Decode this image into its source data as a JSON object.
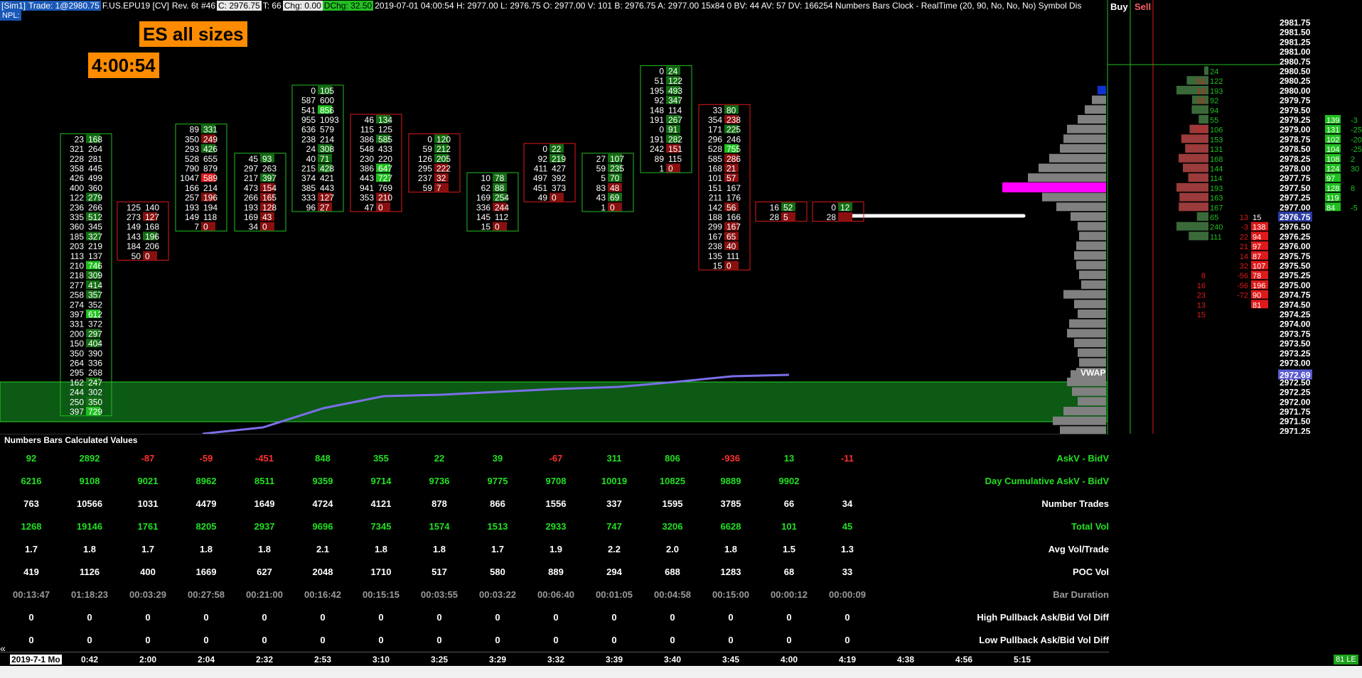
{
  "header": {
    "sim": "[Sim1]",
    "trade": "Trade: 1@2980.75",
    "symbol": "F.US.EPU19 [CV]",
    "rev": "Rev. 6t",
    "num": "#46",
    "close": "C: 2976.75",
    "trades": "T: 66",
    "chg": "Chg: 0.00",
    "dchg": "DChg: 32.50",
    "info": "2019-07-01 04:00:54 H: 2977.00 L: 2976.75 O: 2977.00 V: 101 B: 2976.75 A: 2977.00 15x84 0 BV: 44 AV: 57 DV: 166254 Numbers Bars Clock - RealTime  (20, 90, No, No, No) Symbol Dis",
    "npl": "NPL:",
    "buy": "Buy",
    "sell": "Sell",
    "colors": {
      "sim_bg": "#1a58b8",
      "close_bg": "#e8e8e8",
      "chg_bg": "#e8e8e8",
      "dchg_bg": "#22c022"
    }
  },
  "chart": {
    "title": "ES all sizes",
    "clock": "4:00:54",
    "vwap_label": "VWAP",
    "vwap_value": "2972.69",
    "last_price": "2976.75",
    "colors": {
      "up": "#1fbf1f",
      "down": "#e01a1a",
      "profile": "#808080",
      "poc": "#ff00ff",
      "vwap": "#7b6fe8",
      "zone": "#0c5a14"
    }
  },
  "price_axis": {
    "labels": [
      "2981.75",
      "2981.50",
      "2981.25",
      "2981.00",
      "2980.75",
      "2980.50",
      "2980.25",
      "2980.00",
      "2979.75",
      "2979.50",
      "2979.25",
      "2979.00",
      "2978.75",
      "2978.50",
      "2978.25",
      "2978.00",
      "2977.75",
      "2977.50",
      "2977.25",
      "2977.00",
      "2976.75",
      "2976.50",
      "2976.25",
      "2976.00",
      "2975.75",
      "2975.50",
      "2975.25",
      "2975.00",
      "2974.75",
      "2974.50",
      "2974.25",
      "2974.00",
      "2973.75",
      "2973.50",
      "2973.25",
      "2973.00",
      "2972.75",
      "2972.69",
      "2972.50",
      "2972.25",
      "2972.00",
      "2971.75",
      "2971.50",
      "2971.25"
    ]
  },
  "bars": [
    {
      "time": "0:42",
      "rows": [
        [
          "23",
          "168"
        ],
        [
          "321",
          "264"
        ],
        [
          "228",
          "281"
        ],
        [
          "358",
          "445"
        ],
        [
          "426",
          "499"
        ],
        [
          "400",
          "360"
        ],
        [
          "122",
          "279"
        ],
        [
          "236",
          "266"
        ],
        [
          "335",
          "512"
        ],
        [
          "360",
          "345"
        ],
        [
          "185",
          "327"
        ],
        [
          "203",
          "219"
        ],
        [
          "113",
          "137"
        ],
        [
          "210",
          "746"
        ],
        [
          "218",
          "309"
        ],
        [
          "277",
          "414"
        ],
        [
          "258",
          "357"
        ],
        [
          "274",
          "352"
        ],
        [
          "397",
          "612"
        ],
        [
          "331",
          "372"
        ],
        [
          "200",
          "297"
        ],
        [
          "150",
          "404"
        ],
        [
          "350",
          "390"
        ],
        [
          "264",
          "336"
        ],
        [
          "295",
          "268"
        ],
        [
          "162",
          "247"
        ],
        [
          "244",
          "302"
        ],
        [
          "250",
          "350"
        ],
        [
          "397",
          "729"
        ]
      ],
      "top": "2978.75"
    },
    {
      "time": "2:00",
      "rows": [
        [
          "125",
          "140"
        ],
        [
          "273",
          "127"
        ],
        [
          "149",
          "168"
        ],
        [
          "143",
          "196"
        ],
        [
          "184",
          "206"
        ],
        [
          "50",
          "0"
        ]
      ],
      "top": "2977.00"
    },
    {
      "time": "2:04",
      "rows": [
        [
          "89",
          "331"
        ],
        [
          "350",
          "249"
        ],
        [
          "293",
          "426"
        ],
        [
          "528",
          "655"
        ],
        [
          "790",
          "879"
        ],
        [
          "1047",
          "589"
        ],
        [
          "166",
          "214"
        ],
        [
          "257",
          "196"
        ],
        [
          "193",
          "194"
        ],
        [
          "149",
          "118"
        ],
        [
          "7",
          "0"
        ]
      ],
      "top": "2979.00"
    },
    {
      "time": "2:32",
      "rows": [
        [
          "45",
          "93"
        ],
        [
          "297",
          "263"
        ],
        [
          "217",
          "397"
        ],
        [
          "473",
          "154"
        ],
        [
          "266",
          "165"
        ],
        [
          "193",
          "128"
        ],
        [
          "169",
          "43"
        ],
        [
          "34",
          "0"
        ]
      ],
      "top": "2978.25"
    },
    {
      "time": "2:53",
      "rows": [
        [
          "0",
          "105"
        ],
        [
          "587",
          "600"
        ],
        [
          "541",
          "856"
        ],
        [
          "955",
          "1093"
        ],
        [
          "636",
          "579"
        ],
        [
          "238",
          "214"
        ],
        [
          "24",
          "308"
        ],
        [
          "40",
          "71"
        ],
        [
          "215",
          "428"
        ],
        [
          "374",
          "421"
        ],
        [
          "385",
          "443"
        ],
        [
          "333",
          "127"
        ],
        [
          "96",
          "27"
        ]
      ],
      "top": "2980.00"
    },
    {
      "time": "3:10",
      "rows": [
        [
          "46",
          "134"
        ],
        [
          "115",
          "125"
        ],
        [
          "386",
          "585"
        ],
        [
          "548",
          "433"
        ],
        [
          "230",
          "220"
        ],
        [
          "386",
          "647"
        ],
        [
          "443",
          "727"
        ],
        [
          "941",
          "769"
        ],
        [
          "353",
          "210"
        ],
        [
          "47",
          "0"
        ]
      ],
      "top": "2979.25"
    },
    {
      "time": "3:25",
      "rows": [
        [
          "0",
          "120"
        ],
        [
          "59",
          "212"
        ],
        [
          "126",
          "205"
        ],
        [
          "295",
          "222"
        ],
        [
          "237",
          "32"
        ],
        [
          "59",
          "7"
        ]
      ],
      "top": "2978.75"
    },
    {
      "time": "3:29",
      "rows": [
        [
          "10",
          "78"
        ],
        [
          "62",
          "88"
        ],
        [
          "169",
          "254"
        ],
        [
          "336",
          "244"
        ],
        [
          "145",
          "112"
        ],
        [
          "15",
          "0"
        ]
      ],
      "top": "2977.75"
    },
    {
      "time": "3:32",
      "rows": [
        [
          "0",
          "22"
        ],
        [
          "92",
          "219"
        ],
        [
          "411",
          "427"
        ],
        [
          "497",
          "392"
        ],
        [
          "451",
          "373"
        ],
        [
          "49",
          "0"
        ]
      ],
      "top": "2978.50"
    },
    {
      "time": "3:39",
      "rows": [
        [
          "27",
          "107"
        ],
        [
          "59",
          "235"
        ],
        [
          "5",
          "70"
        ],
        [
          "83",
          "48"
        ],
        [
          "43",
          "69"
        ],
        [
          "1",
          "0"
        ]
      ],
      "top": "2978.25"
    },
    {
      "time": "3:40",
      "rows": [
        [
          "0",
          "24"
        ],
        [
          "51",
          "122"
        ],
        [
          "195",
          "493"
        ],
        [
          "92",
          "347"
        ],
        [
          "148",
          "114"
        ],
        [
          "191",
          "267"
        ],
        [
          "0",
          "91"
        ],
        [
          "191",
          "282"
        ],
        [
          "242",
          "151"
        ],
        [
          "89",
          "115"
        ],
        [
          "1",
          "0"
        ]
      ],
      "top": "2980.50"
    },
    {
      "time": "3:45",
      "rows": [
        [
          "33",
          "80"
        ],
        [
          "354",
          "238"
        ],
        [
          "171",
          "225"
        ],
        [
          "296",
          "246"
        ],
        [
          "528",
          "755"
        ],
        [
          "585",
          "286"
        ],
        [
          "168",
          "21"
        ],
        [
          "101",
          "57"
        ],
        [
          "151",
          "167"
        ],
        [
          "211",
          "176"
        ],
        [
          "142",
          "56"
        ],
        [
          "188",
          "166"
        ],
        [
          "299",
          "167"
        ],
        [
          "167",
          "65"
        ],
        [
          "238",
          "40"
        ],
        [
          "135",
          "111"
        ],
        [
          "15",
          "0"
        ]
      ],
      "top": "2979.50"
    },
    {
      "time": "4:00",
      "rows": [
        [
          "16",
          "52"
        ],
        [
          "28",
          "5"
        ]
      ],
      "top": "2977.00"
    },
    {
      "time": "4:19",
      "rows": [
        [
          "0",
          "12"
        ],
        [
          "28",
          ""
        ]
      ],
      "top": "2977.00"
    }
  ],
  "dom": {
    "left": [
      [
        "24"
      ],
      [
        "122"
      ],
      [
        "193"
      ],
      [
        "92"
      ],
      [
        "94"
      ],
      [
        "55"
      ],
      [
        "106"
      ],
      [
        "153"
      ],
      [
        "131"
      ],
      [
        "168"
      ],
      [
        "144"
      ],
      [
        "114"
      ],
      [
        "193"
      ],
      [
        "163"
      ],
      [
        "167"
      ],
      [
        "65"
      ],
      [
        "240"
      ],
      [
        "111"
      ]
    ],
    "delta_left": [
      "51",
      "19",
      "92",
      "",
      "",
      "17",
      "",
      "",
      "",
      "",
      "",
      "",
      "",
      "",
      "",
      "",
      "",
      "",
      "",
      "",
      "8",
      "16",
      "23",
      "13",
      "15"
    ],
    "bid_right": [
      [
        "13",
        "15"
      ],
      [
        "-3",
        "138"
      ],
      [
        "22",
        "94"
      ],
      [
        "21",
        "97"
      ],
      [
        "14",
        "87"
      ],
      [
        "32",
        "107"
      ],
      [
        "-56",
        "78"
      ],
      [
        "-56",
        "196"
      ],
      [
        "-72",
        "90"
      ],
      [
        "",
        "81"
      ]
    ],
    "ask_right": [
      [
        "139",
        "-3"
      ],
      [
        "131",
        "-25"
      ],
      [
        "102",
        "-20"
      ],
      [
        "104",
        "-25"
      ],
      [
        "108",
        "2"
      ],
      [
        "124",
        "30"
      ],
      [
        "97",
        ""
      ],
      [
        "128",
        "8"
      ],
      [
        "119",
        ""
      ],
      [
        "84",
        "-5"
      ]
    ]
  },
  "calc": {
    "title": "Numbers Bars Calculated Values",
    "rows": [
      {
        "label": "AskV - BidV",
        "values": [
          "92",
          "2892",
          "-87",
          "-59",
          "-451",
          "848",
          "355",
          "22",
          "39",
          "-67",
          "311",
          "806",
          "-936",
          "13",
          "-11"
        ],
        "colors": [
          "g",
          "g",
          "r",
          "r",
          "r",
          "g",
          "g",
          "g",
          "g",
          "r",
          "g",
          "g",
          "r",
          "g",
          "r"
        ]
      },
      {
        "label": "Day Cumulative AskV - BidV",
        "values": [
          "6216",
          "9108",
          "9021",
          "8962",
          "8511",
          "9359",
          "9714",
          "9736",
          "9775",
          "9708",
          "10019",
          "10825",
          "9889",
          "9902",
          ""
        ],
        "colors": [
          "g",
          "g",
          "g",
          "g",
          "g",
          "g",
          "g",
          "g",
          "g",
          "g",
          "g",
          "g",
          "g",
          "g",
          "g"
        ]
      },
      {
        "label": "Number Trades",
        "values": [
          "763",
          "10566",
          "1031",
          "4479",
          "1649",
          "4724",
          "4121",
          "878",
          "866",
          "1556",
          "337",
          "1595",
          "3785",
          "66",
          "34"
        ],
        "colors": [
          "w",
          "w",
          "w",
          "w",
          "w",
          "w",
          "w",
          "w",
          "w",
          "w",
          "w",
          "w",
          "w",
          "w",
          "w"
        ]
      },
      {
        "label": "Total Vol",
        "values": [
          "1268",
          "19146",
          "1761",
          "8205",
          "2937",
          "9696",
          "7345",
          "1574",
          "1513",
          "2933",
          "747",
          "3206",
          "6628",
          "101",
          "45"
        ],
        "colors": [
          "g",
          "g",
          "g",
          "g",
          "g",
          "g",
          "g",
          "g",
          "g",
          "g",
          "g",
          "g",
          "g",
          "g",
          "g"
        ]
      },
      {
        "label": "Avg Vol/Trade",
        "values": [
          "1.7",
          "1.8",
          "1.7",
          "1.8",
          "1.8",
          "2.1",
          "1.8",
          "1.8",
          "1.7",
          "1.9",
          "2.2",
          "2.0",
          "1.8",
          "1.5",
          "1.3"
        ],
        "colors": [
          "w",
          "w",
          "w",
          "w",
          "w",
          "w",
          "w",
          "w",
          "w",
          "w",
          "w",
          "w",
          "w",
          "w",
          "w"
        ]
      },
      {
        "label": "POC Vol",
        "values": [
          "419",
          "1126",
          "400",
          "1669",
          "627",
          "2048",
          "1710",
          "517",
          "580",
          "889",
          "294",
          "688",
          "1283",
          "68",
          "33"
        ],
        "colors": [
          "w",
          "w",
          "w",
          "w",
          "w",
          "w",
          "w",
          "w",
          "w",
          "w",
          "w",
          "w",
          "w",
          "w",
          "w"
        ]
      },
      {
        "label": "Bar Duration",
        "values": [
          "00:13:47",
          "01:18:23",
          "00:03:29",
          "00:27:58",
          "00:21:00",
          "00:16:42",
          "00:15:15",
          "00:03:55",
          "00:03:22",
          "00:06:40",
          "00:01:05",
          "00:04:58",
          "00:15:00",
          "00:00:12",
          "00:00:09"
        ],
        "colors": [
          "d",
          "d",
          "d",
          "d",
          "d",
          "d",
          "d",
          "d",
          "d",
          "d",
          "d",
          "d",
          "d",
          "d",
          "d"
        ]
      },
      {
        "label": "High Pullback Ask/Bid Vol Diff",
        "values": [
          "0",
          "0",
          "0",
          "0",
          "0",
          "0",
          "0",
          "0",
          "0",
          "0",
          "0",
          "0",
          "0",
          "0",
          "0"
        ],
        "colors": [
          "w",
          "w",
          "w",
          "w",
          "w",
          "w",
          "w",
          "w",
          "w",
          "w",
          "w",
          "w",
          "w",
          "w",
          "w"
        ]
      },
      {
        "label": "Low Pullback Ask/Bid Vol Diff",
        "values": [
          "0",
          "0",
          "0",
          "0",
          "0",
          "0",
          "0",
          "0",
          "0",
          "0",
          "0",
          "0",
          "0",
          "0",
          "0"
        ],
        "colors": [
          "w",
          "w",
          "w",
          "w",
          "w",
          "w",
          "w",
          "w",
          "w",
          "w",
          "w",
          "w",
          "w",
          "w",
          "w"
        ]
      }
    ]
  },
  "time_axis": {
    "date": "2019-7-1 Mo",
    "labels": [
      "0:42",
      "2:00",
      "2:04",
      "2:32",
      "2:53",
      "3:10",
      "3:25",
      "3:29",
      "3:32",
      "3:39",
      "3:40",
      "3:45",
      "4:00",
      "4:19",
      "4:38",
      "4:56",
      "5:15"
    ]
  },
  "status": {
    "badge": "81 LE",
    "scroll": "«"
  }
}
